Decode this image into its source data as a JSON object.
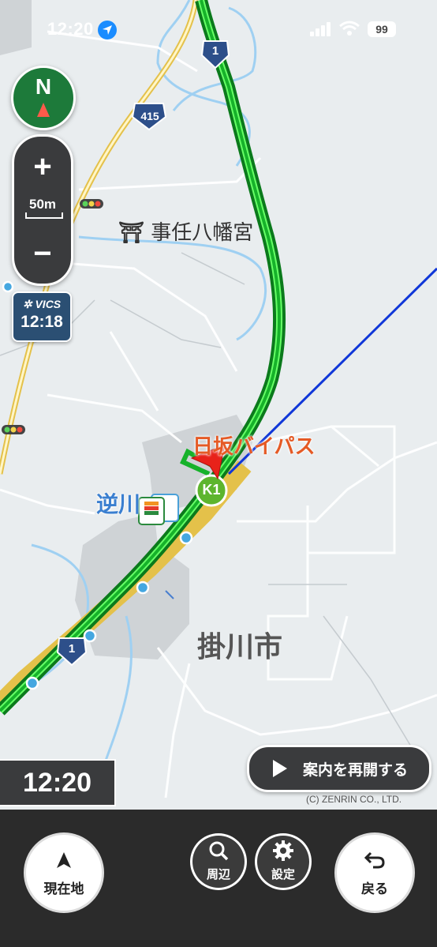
{
  "status_bar": {
    "time": "12:20",
    "battery": "99"
  },
  "map": {
    "labels": {
      "shrine": "事任八幡宮",
      "bypass": "日坂バイパス",
      "sakagawa": "逆川",
      "city": "掛川市",
      "route_1_top": "1",
      "route_415": "415",
      "route_1_bottom": "1",
      "interchange": "K1"
    },
    "route_color": "#00a82d",
    "accent_blue": "#1037d8",
    "copyright": "(C) ZENRIN CO., LTD."
  },
  "controls": {
    "compass": "N",
    "zoom_in": "+",
    "zoom_out": "−",
    "scale": "50m",
    "vics_label": "VICS",
    "vics_time": "12:18",
    "clock": "12:20",
    "resume_label": "案内を再開する"
  },
  "bottom_bar": {
    "current_location": "現在地",
    "nearby": "周辺",
    "settings": "設定",
    "back": "戻る"
  }
}
